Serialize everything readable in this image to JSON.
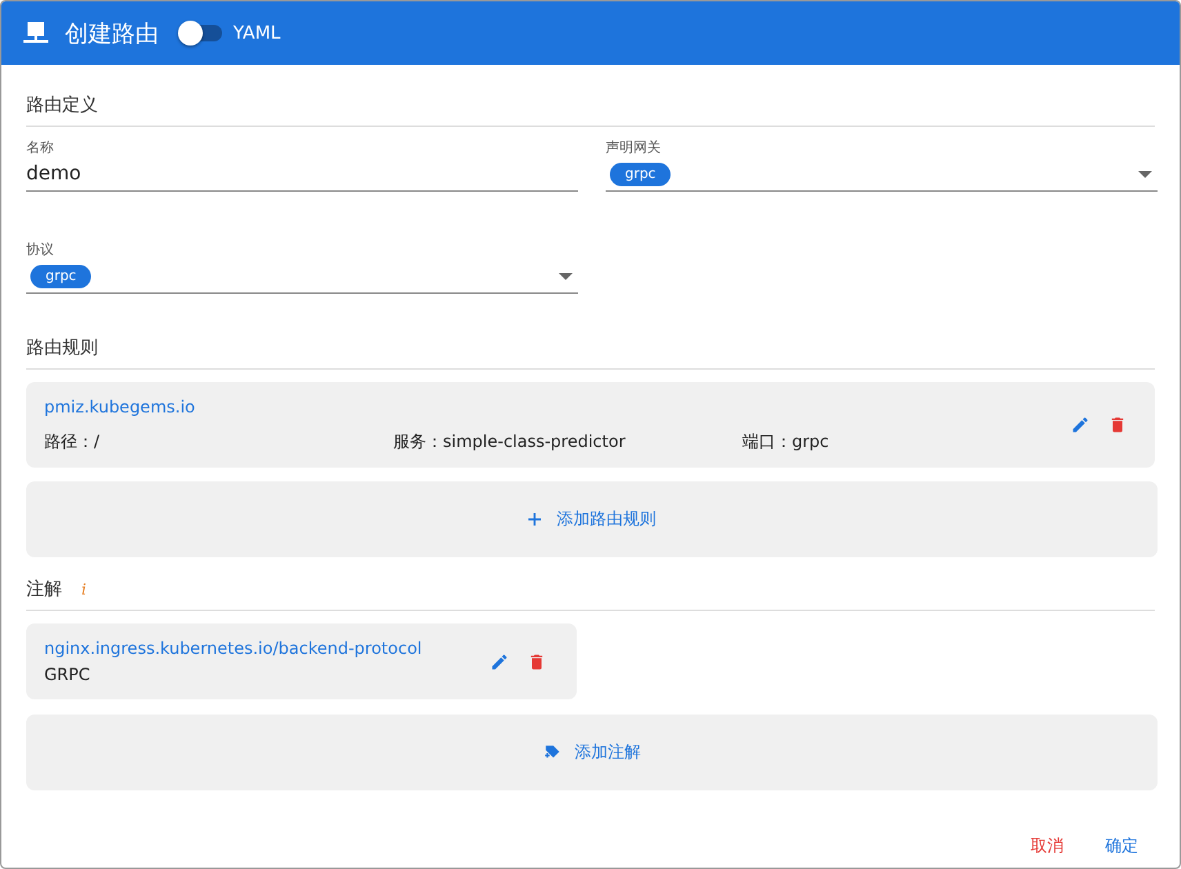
{
  "window": {
    "title": "创建路由",
    "yaml_toggle": {
      "label": "YAML",
      "on": false
    }
  },
  "sections": [
    {
      "title": "路由定义"
    },
    {
      "title": "路由规则"
    },
    {
      "title": "注解"
    }
  ],
  "fields": [
    {
      "kind": "text",
      "label": "名称",
      "value": "demo"
    },
    {
      "kind": "select",
      "label": "声明网关",
      "chips": [
        "grpc"
      ]
    },
    {
      "kind": "select",
      "label": "协议",
      "chips": [
        "grpc"
      ]
    }
  ],
  "rules": [
    {
      "host": "pmiz.kubegems.io",
      "path": "路径：/",
      "service": "服务：simple-class-predictor",
      "port": "端口：grpc"
    }
  ],
  "add_rule_button": "添加路由规则",
  "annotations": [
    {
      "key": "nginx.ingress.kubernetes.io/backend-protocol",
      "value": "GRPC"
    }
  ],
  "add_annotation_button": "添加注解",
  "info_mark": "i",
  "buttons": [
    {
      "label": "取消",
      "kind": "cancel"
    },
    {
      "label": "确定",
      "kind": "confirm"
    }
  ]
}
